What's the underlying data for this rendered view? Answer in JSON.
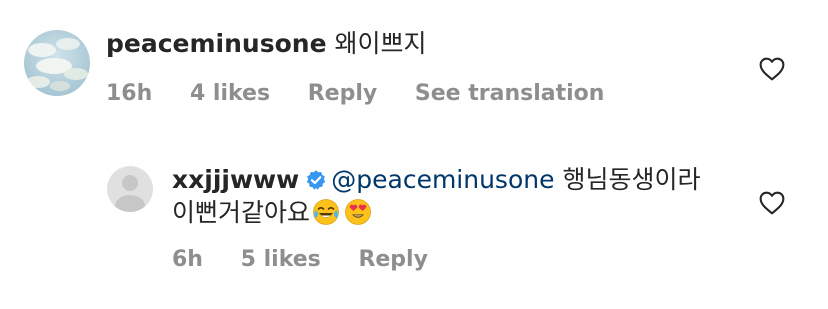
{
  "comment": {
    "username": "peaceminusone",
    "text": "왜이쁘지",
    "time": "16h",
    "likes": "4 likes",
    "reply_label": "Reply",
    "translate_label": "See translation",
    "like_icon": "heart-outline-icon"
  },
  "reply": {
    "username": "xxjjjwww",
    "verified_icon": "verified-badge-icon",
    "mention": "@peaceminusone",
    "text_line1": "행님동생이라",
    "text_line2": "이뻔거같아요",
    "emojis": [
      "face-with-tears-of-joy",
      "smiling-face-with-heart-eyes"
    ],
    "time": "6h",
    "likes": "5 likes",
    "reply_label": "Reply",
    "like_icon": "heart-outline-icon"
  },
  "colors": {
    "text": "#262626",
    "secondary": "#8e8e8e",
    "mention": "#00376b",
    "verified": "#3897f0"
  }
}
